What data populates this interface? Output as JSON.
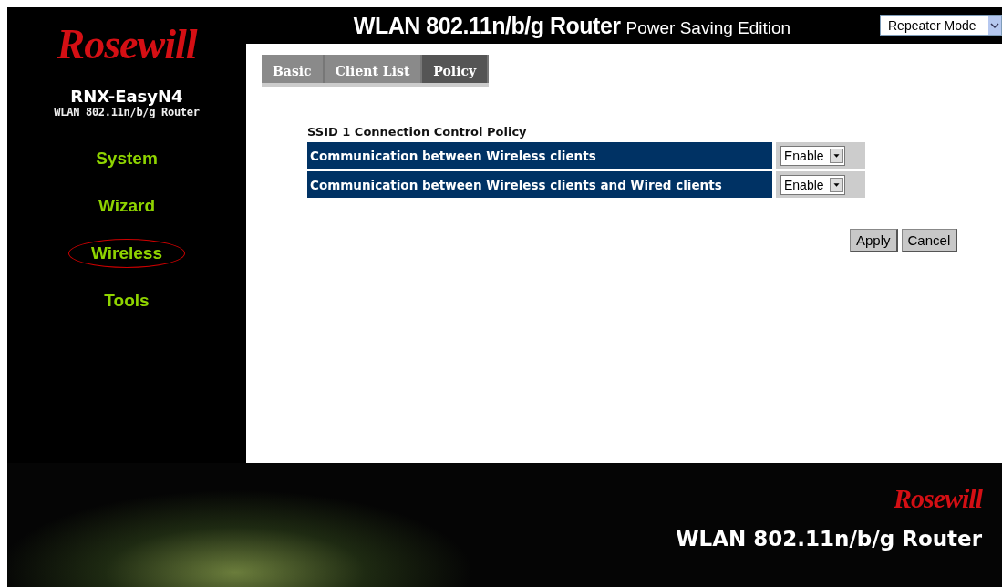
{
  "header": {
    "logo": "Rosewill",
    "title": "WLAN 802.11n/b/g Router",
    "subtitle": "Power Saving Edition",
    "mode_select": {
      "value": "Repeater Mode"
    }
  },
  "sidebar": {
    "model": "RNX-EasyN4",
    "model_subtitle": "WLAN 802.11n/b/g Router",
    "items": [
      {
        "label": "System",
        "selected": false
      },
      {
        "label": "Wizard",
        "selected": false
      },
      {
        "label": "Wireless",
        "selected": true
      },
      {
        "label": "Tools",
        "selected": false
      }
    ]
  },
  "tabs": [
    {
      "label": "Basic",
      "selected": false
    },
    {
      "label": "Client List",
      "selected": false
    },
    {
      "label": "Policy",
      "selected": true
    }
  ],
  "policy": {
    "title": "SSID 1 Connection Control Policy",
    "rows": [
      {
        "label": "Communication between Wireless clients",
        "value": "Enable"
      },
      {
        "label": "Communication between Wireless clients and Wired clients",
        "value": "Enable"
      }
    ]
  },
  "buttons": [
    "Apply",
    "Cancel"
  ],
  "footer": {
    "logo": "Rosewill",
    "title": "WLAN 802.11n/b/g Router"
  }
}
